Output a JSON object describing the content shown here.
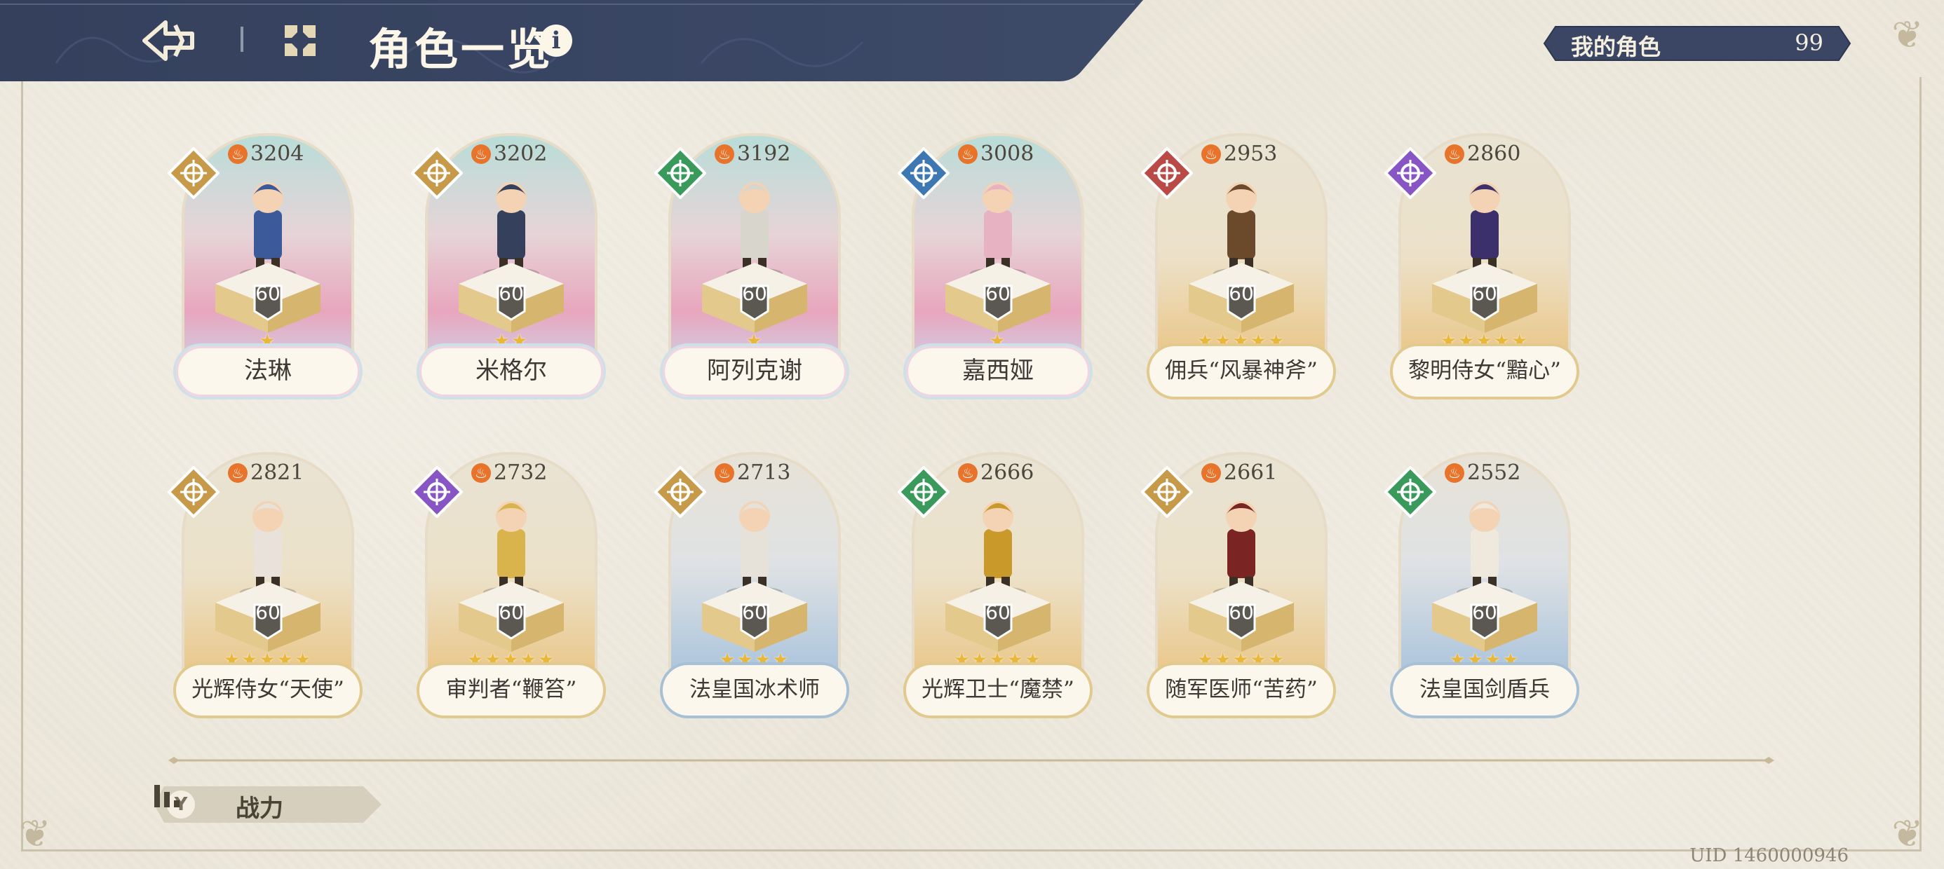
{
  "header": {
    "title": "角色一览",
    "info_glyph": "i"
  },
  "role_count": {
    "label": "我的角色",
    "value": "99"
  },
  "colors": {
    "header_navy": "#3a4663",
    "gold_badge": "#c79a4a",
    "green_badge": "#3a9a5c",
    "blue_badge": "#3e78b3",
    "red_badge": "#b94a46",
    "purple_badge": "#8756c4"
  },
  "characters": [
    {
      "name": "法琳",
      "power": "3204",
      "level": "60",
      "stars": "★",
      "badge_icon": "gold-compass-icon"
    },
    {
      "name": "米格尔",
      "power": "3202",
      "level": "60",
      "stars": "★★",
      "badge_icon": "gold-compass-icon"
    },
    {
      "name": "阿列克谢",
      "power": "3192",
      "level": "60",
      "stars": "★",
      "badge_icon": "green-shield-icon"
    },
    {
      "name": "嘉西娅",
      "power": "3008",
      "level": "60",
      "stars": "★",
      "badge_icon": "blue-crossed-swords-icon"
    },
    {
      "name": "佣兵“风暴神斧”",
      "power": "2953",
      "level": "60",
      "stars": "★★★★★",
      "badge_icon": "red-sword-icon"
    },
    {
      "name": "黎明侍女“黯心”",
      "power": "2860",
      "level": "60",
      "stars": "★★★★★",
      "badge_icon": "purple-swirl-icon"
    },
    {
      "name": "光辉侍女“天使”",
      "power": "2821",
      "level": "60",
      "stars": "★★★★★",
      "badge_icon": "gold-compass-icon"
    },
    {
      "name": "审判者“鞭笞”",
      "power": "2732",
      "level": "60",
      "stars": "★★★★★",
      "badge_icon": "purple-swirl-icon"
    },
    {
      "name": "法皇国冰术师",
      "power": "2713",
      "level": "60",
      "stars": "★★★★",
      "badge_icon": "gold-compass-icon"
    },
    {
      "name": "光辉卫士“魔禁”",
      "power": "2666",
      "level": "60",
      "stars": "★★★★★",
      "badge_icon": "green-shield-icon"
    },
    {
      "name": "随军医师“苦药”",
      "power": "2661",
      "level": "60",
      "stars": "★★★★★",
      "badge_icon": "gold-compass-icon"
    },
    {
      "name": "法皇国剑盾兵",
      "power": "2552",
      "level": "60",
      "stars": "★★★★",
      "badge_icon": "green-shield-icon"
    }
  ],
  "sort_filter": {
    "label": "战力"
  },
  "uid": "UID 1460000946"
}
